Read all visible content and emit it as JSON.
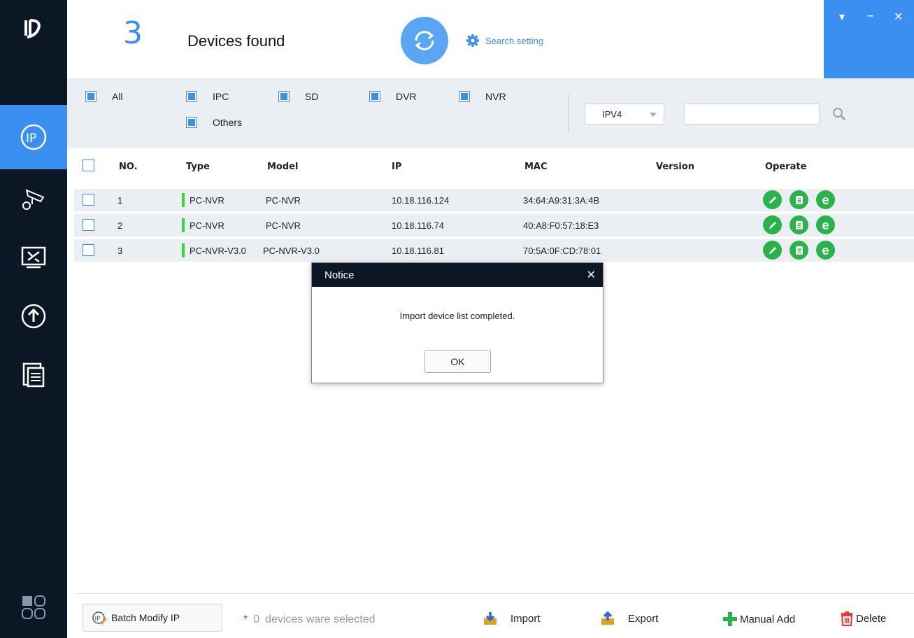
{
  "header": {
    "device_count": "3",
    "devices_found_label": "Devices found",
    "search_setting_label": "Search setting"
  },
  "window_controls": {
    "menu": "▾",
    "minimize": "–",
    "close": "✕"
  },
  "filters": {
    "all": "All",
    "ipc": "IPC",
    "sd": "SD",
    "dvr": "DVR",
    "nvr": "NVR",
    "others": "Others",
    "ip_version": "IPV4",
    "search_value": ""
  },
  "table": {
    "headers": {
      "no": "NO.",
      "type": "Type",
      "model": "Model",
      "ip": "IP",
      "mac": "MAC",
      "version": "Version",
      "operate": "Operate"
    },
    "rows": [
      {
        "no": "1",
        "type": "PC-NVR",
        "model": "PC-NVR",
        "ip": "10.18.116.124",
        "mac": "34:64:A9:31:3A:4B",
        "version": ""
      },
      {
        "no": "2",
        "type": "PC-NVR",
        "model": "PC-NVR",
        "ip": "10.18.116.74",
        "mac": "40:A8:F0:57:18:E3",
        "version": ""
      },
      {
        "no": "3",
        "type": "PC-NVR-V3.0",
        "model": "PC-NVR-V3.0",
        "ip": "10.18.116.81",
        "mac": "70:5A:0F:CD:78:01",
        "version": ""
      }
    ]
  },
  "footer": {
    "batch_modify_label": "Batch Modify IP",
    "selected_star": "*",
    "selected_count": "0",
    "selected_text": "devices ware selected",
    "import_label": "Import",
    "export_label": "Export",
    "manual_add_label": "Manual Add",
    "delete_label": "Delete"
  },
  "dialog": {
    "title": "Notice",
    "close": "✕",
    "message": "Import device list completed.",
    "ok_label": "OK"
  },
  "colors": {
    "accent": "#3a8ff0",
    "sidebar": "#0c1726",
    "status_green": "#35d635",
    "op_green": "#2ab24b"
  }
}
